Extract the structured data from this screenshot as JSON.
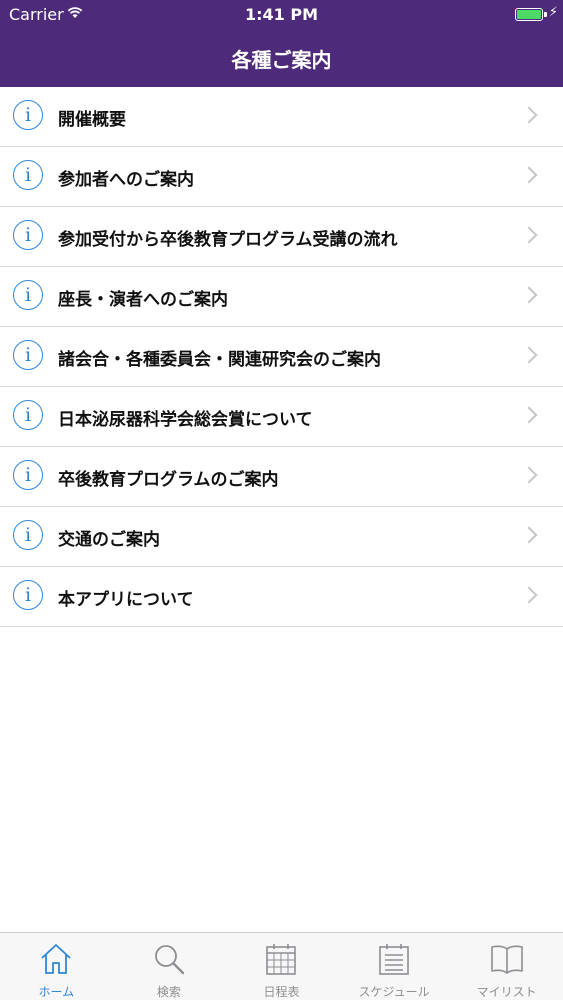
{
  "status_bar": {
    "carrier": "Carrier",
    "time": "1:41 PM",
    "battery_icon": "battery-icon",
    "wifi_icon": "wifi-icon"
  },
  "nav": {
    "title": "各種ご案内",
    "color": "#4e2a7a"
  },
  "menu": {
    "icon": "info-circle-icon",
    "icon_glyph": "i",
    "items": [
      {
        "label": "開催概要"
      },
      {
        "label": "参加者へのご案内"
      },
      {
        "label": "参加受付から卒後教育プログラム受講の流れ"
      },
      {
        "label": "座長・演者へのご案内"
      },
      {
        "label": "諸会合・各種委員会・関連研究会のご案内"
      },
      {
        "label": "日本泌尿器科学会総会賞について"
      },
      {
        "label": "卒後教育プログラムのご案内"
      },
      {
        "label": "交通のご案内"
      },
      {
        "label": "本アプリについて"
      }
    ]
  },
  "tabs": {
    "active_color": "#2e86d8",
    "items": [
      {
        "label": "ホーム",
        "icon": "home-icon",
        "active": true
      },
      {
        "label": "検索",
        "icon": "search-icon",
        "active": false
      },
      {
        "label": "日程表",
        "icon": "calendar-grid-icon",
        "active": false
      },
      {
        "label": "スケジュール",
        "icon": "schedule-list-icon",
        "active": false
      },
      {
        "label": "マイリスト",
        "icon": "book-icon",
        "active": false
      }
    ]
  }
}
